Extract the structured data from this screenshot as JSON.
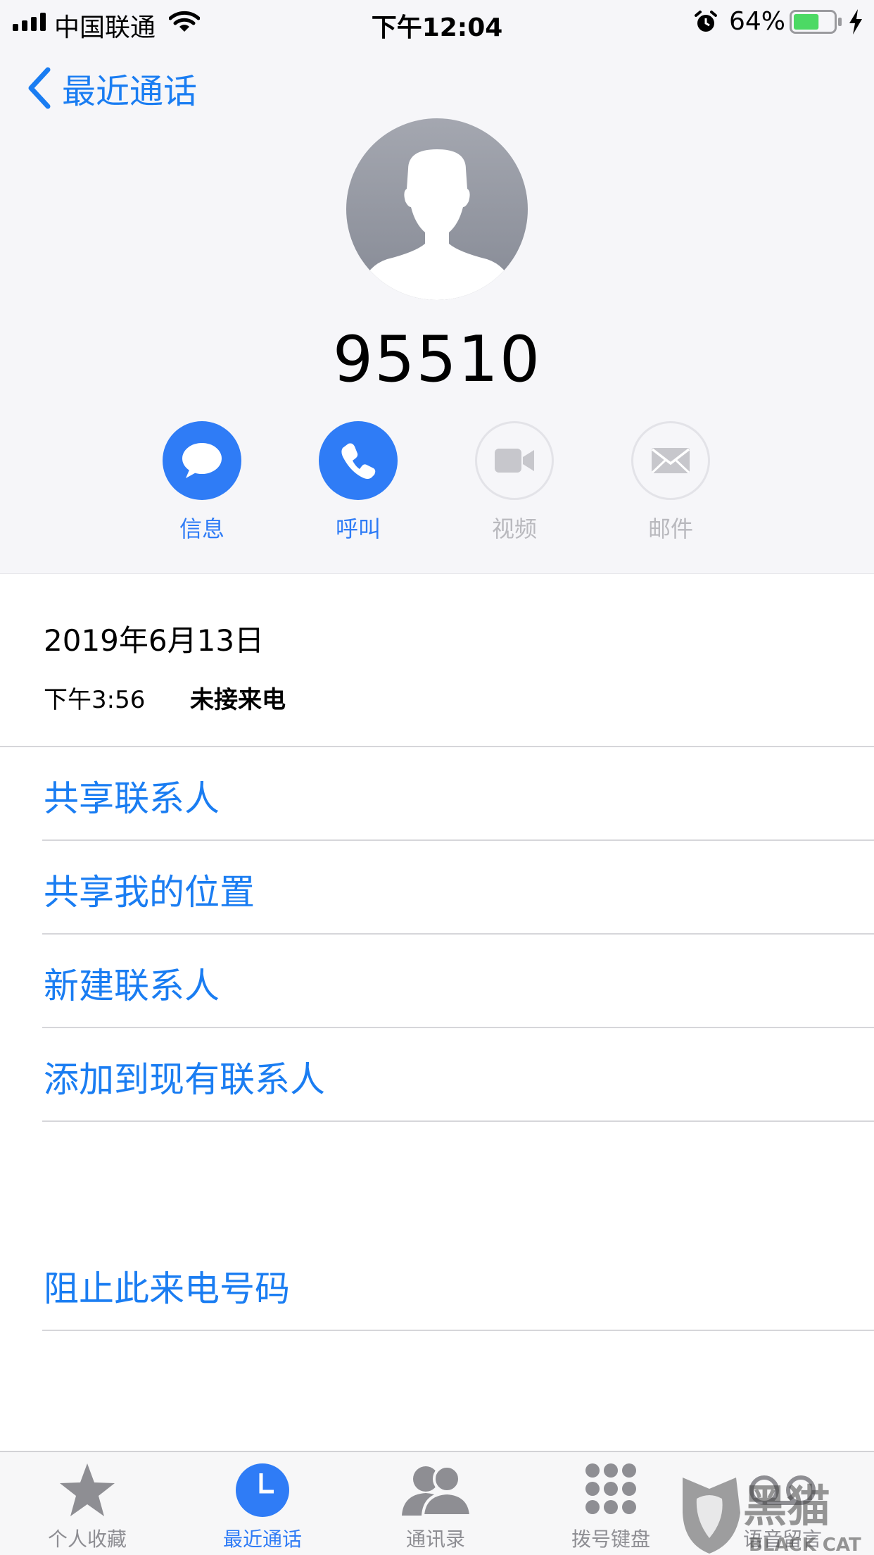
{
  "status_bar": {
    "carrier": "中国联通",
    "time": "下午12:04",
    "battery_percent": "64%",
    "battery_level": 0.64
  },
  "nav": {
    "back_label": "最近通话"
  },
  "contact": {
    "number": "95510"
  },
  "actions": [
    {
      "label": "信息",
      "icon": "message-icon",
      "enabled": true
    },
    {
      "label": "呼叫",
      "icon": "phone-icon",
      "enabled": true
    },
    {
      "label": "视频",
      "icon": "video-icon",
      "enabled": false
    },
    {
      "label": "邮件",
      "icon": "mail-icon",
      "enabled": false
    }
  ],
  "call": {
    "date": "2019年6月13日",
    "time": "下午3:56",
    "status": "未接来电"
  },
  "options": [
    "共享联系人",
    "共享我的位置",
    "新建联系人",
    "添加到现有联系人"
  ],
  "block_label": "阻止此来电号码",
  "tabs": [
    {
      "label": "个人收藏",
      "icon": "star-icon",
      "active": false
    },
    {
      "label": "最近通话",
      "icon": "clock-icon",
      "active": true
    },
    {
      "label": "通讯录",
      "icon": "contacts-icon",
      "active": false
    },
    {
      "label": "拨号键盘",
      "icon": "keypad-icon",
      "active": false
    },
    {
      "label": "语音留言",
      "icon": "voicemail-icon",
      "active": false
    }
  ],
  "watermark": {
    "text": "黑猫",
    "subtext": "BLACK CAT"
  },
  "colors": {
    "accent": "#2f7cf6",
    "link": "#1a7df2",
    "battery": "#4cd964"
  }
}
